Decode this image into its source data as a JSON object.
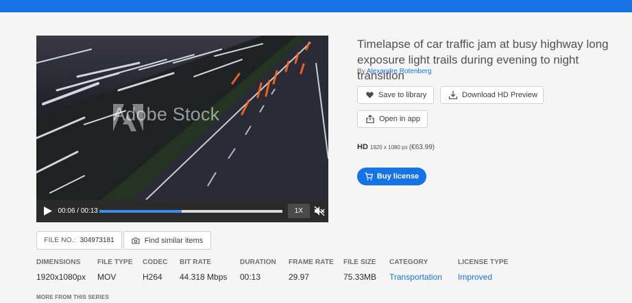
{
  "colors": {
    "accent": "#1473e6",
    "topbar": "#1473e6"
  },
  "video": {
    "watermark": "Adobe Stock",
    "time_display": "00:06 / 00:13",
    "progress_fraction": 0.45,
    "speed_label": "1X",
    "icons": {
      "play": "play-icon",
      "mute": "mute-icon"
    }
  },
  "asset": {
    "title": "Timelapse of car traffic jam at busy highway long exposure light trails during evening to night transition",
    "by_label": "By",
    "author": "Alexandre Rotenberg"
  },
  "actions": {
    "save_label": "Save to library",
    "download_label": "Download HD Preview",
    "open_label": "Open in app",
    "buy_label": "Buy license"
  },
  "license": {
    "quality": "HD",
    "resolution": "1920 x 1080 px",
    "price": "(€63.99)"
  },
  "file": {
    "label": "FILE NO.:",
    "number": "304973181",
    "similar_label": "Find similar items"
  },
  "specs": [
    {
      "key": "DIMENSIONS",
      "value": "1920x1080px"
    },
    {
      "key": "FILE TYPE",
      "value": "MOV"
    },
    {
      "key": "CODEC",
      "value": "H264"
    },
    {
      "key": "BIT RATE",
      "value": "44.318 Mbps"
    },
    {
      "key": "DURATION",
      "value": "00:13"
    },
    {
      "key": "FRAME RATE",
      "value": "29.97"
    },
    {
      "key": "FILE SIZE",
      "value": "75.33MB"
    },
    {
      "key": "CATEGORY",
      "value": "Transportation"
    },
    {
      "key": "LICENSE TYPE",
      "value": "Improved"
    }
  ],
  "more_heading": "MORE FROM THIS SERIES"
}
